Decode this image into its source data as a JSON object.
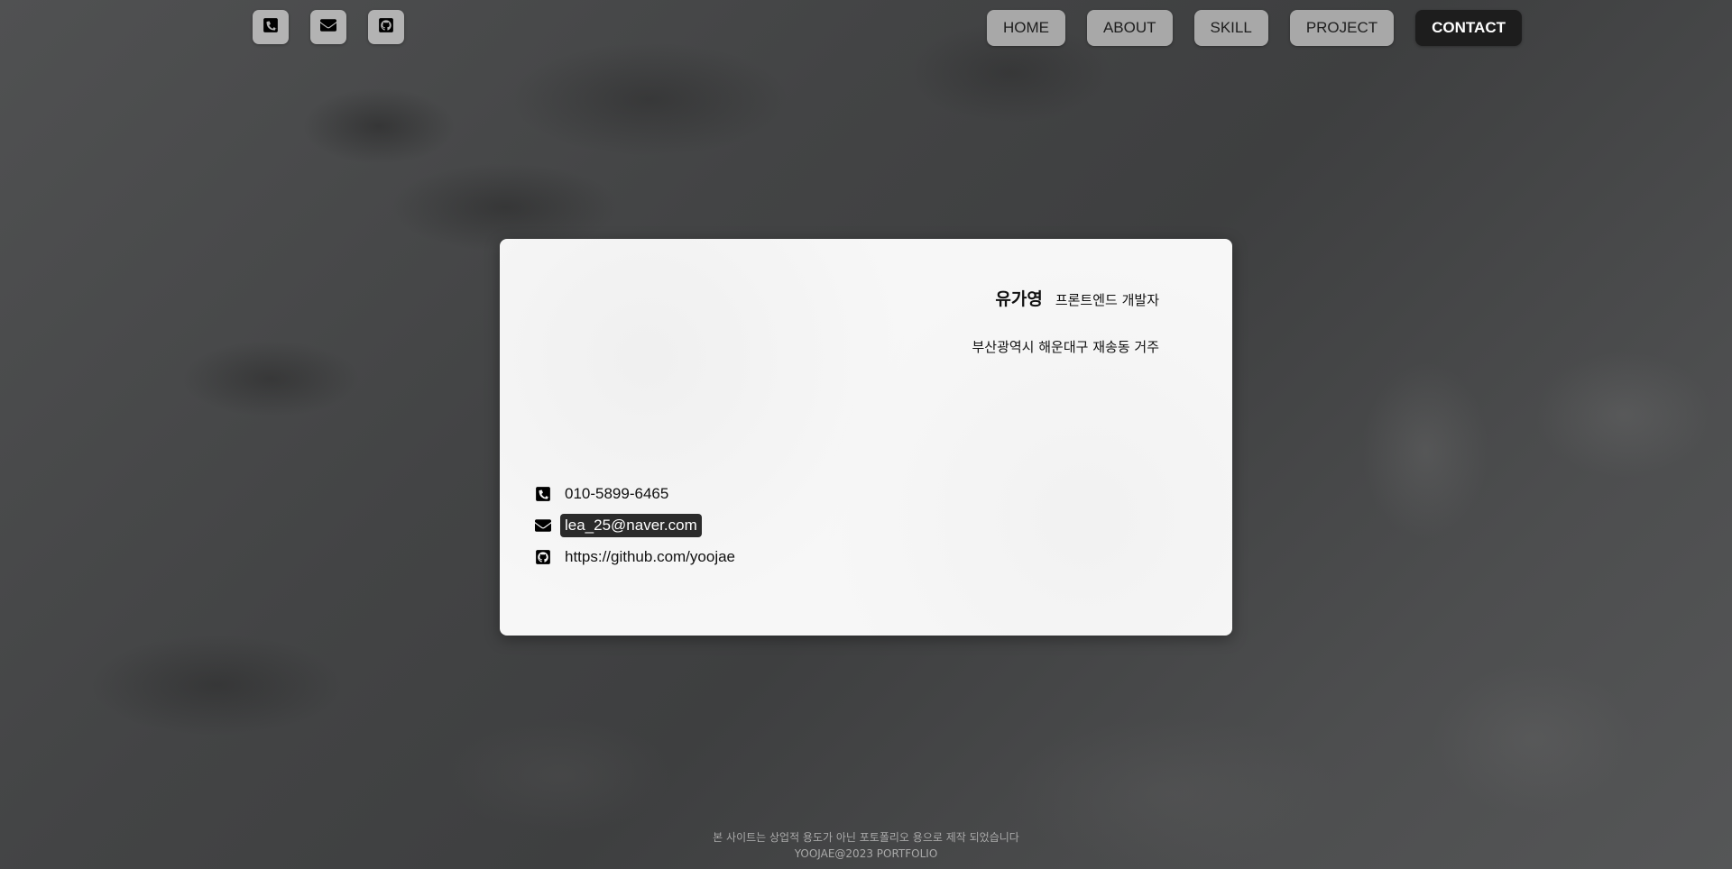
{
  "social": [
    {
      "icon": "phone-icon"
    },
    {
      "icon": "mail-icon"
    },
    {
      "icon": "github-icon"
    }
  ],
  "nav": {
    "home": "HOME",
    "about": "ABOUT",
    "skill": "SKILL",
    "project": "PROJECT",
    "contact": "CONTACT",
    "active": "CONTACT"
  },
  "card": {
    "name": "유가영",
    "role": "프론트엔드 개발자",
    "address": "부산광역시 해운대구 재송동 거주",
    "phone": "010-5899-6465",
    "email": "lea_25@naver.com",
    "github": "https://github.com/yoojae"
  },
  "footer": {
    "notice": "본 사이트는 상업적 용도가 아닌 포토폴리오 용으로 제작 되었습니다",
    "copyright": "YOOJAE@2023 PORTFOLIO"
  },
  "colors": {
    "nav_button": "#a8a8a8",
    "nav_active": "#1d1d1d",
    "card_bg": "#f7f7f7",
    "highlight": "#2b2b2b"
  }
}
